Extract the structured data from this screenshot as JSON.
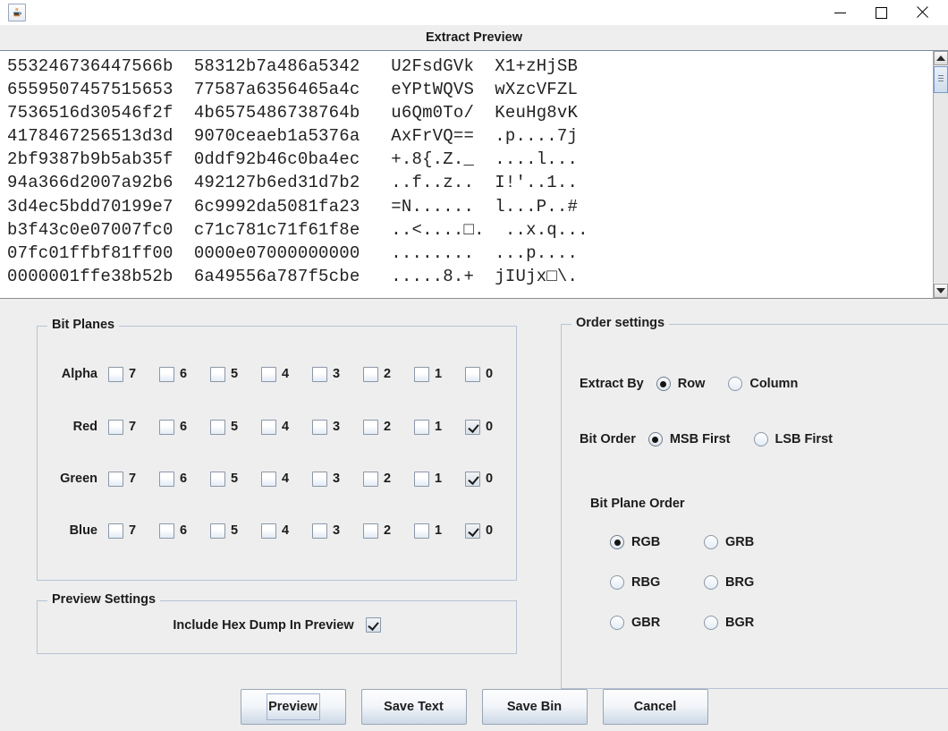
{
  "window": {
    "app_icon": "java-coffee-cup-icon",
    "minimize_label": "minimize-icon",
    "maximize_label": "maximize-icon",
    "close_label": "close-icon"
  },
  "header": {
    "title": "Extract Preview"
  },
  "preview": {
    "hex_dump": "553246736447566b  58312b7a486a5342   U2FsdGVk  X1+zHjSB\n6559507457515653  77587a6356465a4c   eYPtWQVS  wXzcVFZL\n7536516d30546f2f  4b6575486738764b   u6Qm0To/  KeuHg8vK\n4178467256513d3d  9070ceaeb1a5376a   AxFrVQ==  .p....7j\n2bf9387b9b5ab35f  0ddf92b46c0ba4ec   +.8{.Z._  ....l...\n94a366d2007a92b6  492127b6ed31d7b2   ..f..z..  I!'..1..\n3d4ec5bdd70199e7  6c9992da5081fa23   =N......  l...P..#\nb3f43c0e07007fc0  c71c781c71f61f8e   ..<....□.  ..x.q...\n07fc01ffbf81ff00  0000e07000000000   ........  ...p....\n0000001ffe38b52b  6a49556a787f5cbe   .....8.+  jIUjx□\\.",
    "scrollbar": {
      "up_arrow": "scroll-up-icon",
      "down_arrow": "scroll-down-icon"
    }
  },
  "bit_planes": {
    "panel_title": "Bit Planes",
    "bit_labels": [
      "7",
      "6",
      "5",
      "4",
      "3",
      "2",
      "1",
      "0"
    ],
    "rows": [
      {
        "channel": "Alpha",
        "checked": [
          false,
          false,
          false,
          false,
          false,
          false,
          false,
          false
        ]
      },
      {
        "channel": "Red",
        "checked": [
          false,
          false,
          false,
          false,
          false,
          false,
          false,
          true
        ]
      },
      {
        "channel": "Green",
        "checked": [
          false,
          false,
          false,
          false,
          false,
          false,
          false,
          true
        ]
      },
      {
        "channel": "Blue",
        "checked": [
          false,
          false,
          false,
          false,
          false,
          false,
          false,
          true
        ]
      }
    ]
  },
  "order_settings": {
    "panel_title": "Order settings",
    "extract_by": {
      "caption": "Extract By",
      "options": [
        "Row",
        "Column"
      ],
      "selected": "Row"
    },
    "bit_order": {
      "caption": "Bit Order",
      "options": [
        "MSB First",
        "LSB First"
      ],
      "selected": "MSB First"
    },
    "bit_plane_order": {
      "caption": "Bit Plane Order",
      "options": [
        "RGB",
        "GRB",
        "RBG",
        "BRG",
        "GBR",
        "BGR"
      ],
      "selected": "RGB"
    }
  },
  "preview_settings": {
    "panel_title": "Preview Settings",
    "include_hex_dump": {
      "label": "Include Hex Dump In Preview",
      "checked": true
    }
  },
  "buttons": [
    {
      "label": "Preview",
      "focused": true
    },
    {
      "label": "Save Text",
      "focused": false
    },
    {
      "label": "Save Bin",
      "focused": false
    },
    {
      "label": "Cancel",
      "focused": false
    }
  ]
}
